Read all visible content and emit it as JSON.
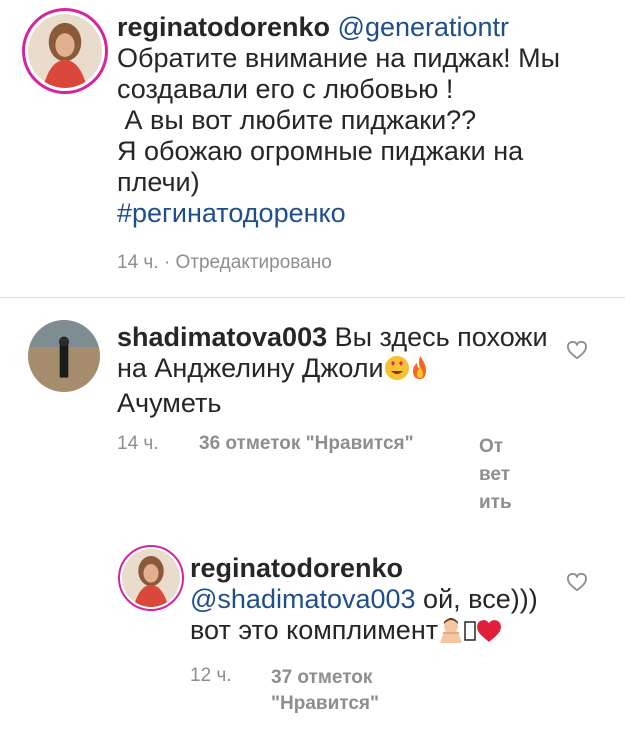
{
  "post": {
    "username": "reginatodorenko",
    "mention": "@generationtr",
    "lines": [
      "Обратите внимание на пиджак! Мы",
      "создавали  его с любовью !",
      " А вы вот любите пиджаки??",
      "Я обожаю огромные пиджаки на",
      "плечи)"
    ],
    "hashtag": "#регинатодоренко",
    "meta": "14 ч. · Отредактировано"
  },
  "comment1": {
    "username": "shadimatova003",
    "text_line1": "Вы здесь похожи",
    "text_line2": "на Анджелину Джоли",
    "text_line3": "Ачуметь",
    "time": "14 ч.",
    "likes": "36 отметок \"Нравится\"",
    "reply_lines": [
      "От",
      "вет",
      "ить"
    ]
  },
  "reply": {
    "username": "reginatodorenko",
    "mention": "@shadimatova003",
    "text_line1_rest": " ой, все)))",
    "text_line2": "вот это комплимент",
    "time": "12 ч.",
    "likes_line1": "37 отметок",
    "likes_line2": "\"Нравится\""
  },
  "icons": {
    "like": "heart-outline-icon",
    "emoji1": "heart-eyes-emoji",
    "emoji2": "fire-emoji",
    "emoji3": "person-gesturing-emoji",
    "emoji4": "red-heart-emoji"
  },
  "colors": {
    "link": "#1f4f8b",
    "meta": "#8e8e8e",
    "story_ring": "#d6249f"
  }
}
